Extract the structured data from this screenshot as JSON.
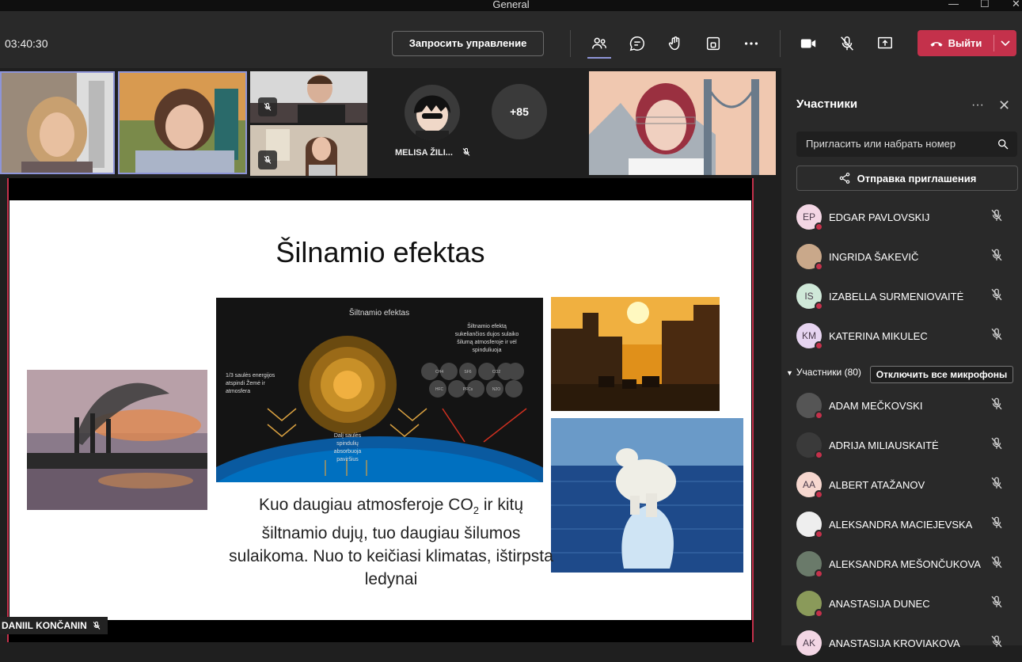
{
  "window": {
    "title": "General",
    "minimize": "—",
    "maximize": "☐",
    "close": "✕"
  },
  "toolbar": {
    "timer": "03:40:30",
    "request_control": "Запросить управление",
    "leave": "Выйти"
  },
  "stage": {
    "melisa_name": "MELISA ŽILI...",
    "more_count": "+85",
    "presenter_name": "DANIIL KONČANIN"
  },
  "slide": {
    "title": "Šilnamio efektas",
    "caption_part1": "Kuo daugiau atmosferoje CO",
    "caption_sub": "2",
    "caption_part2": " ir kitų šiltnamio dujų, tuo daugiau šilumos sulaikoma. Nuo to keičiasi klimatas, ištirpsta ledynai",
    "diagram": {
      "title": "Šiltnamio efektas",
      "right_text": [
        "Šiltnamio efektą",
        "sukeliančios dujos sulaiko",
        "šilumą atmosferoje ir vėl",
        "spinduliuoja"
      ],
      "left_text": [
        "1/3 saulės energijos",
        "atspindi Žemė ir",
        "atmosfera"
      ],
      "bottom_text": [
        "Dalį saulės",
        "spindulių",
        "absorbuoja",
        "paviršius"
      ],
      "gases": [
        "CH4",
        "SF6",
        "CO2",
        "HFC",
        "PFCs",
        "N2O"
      ]
    }
  },
  "panel": {
    "title": "Участники",
    "more": "···",
    "close": "✕",
    "invite_placeholder": "Пригласить или набрать номер",
    "send_invite": "Отправка приглашения",
    "presenters": [
      {
        "initials": "EP",
        "name": "EDGAR PAVLOVSKIJ",
        "color": "#f3d6e4"
      },
      {
        "initials": "",
        "name": "INGRIDA ŠAKEVIČ",
        "color": "#c9a88a"
      },
      {
        "initials": "IS",
        "name": "IZABELLA SURMENIOVAITĖ",
        "color": "#cfe8d8"
      },
      {
        "initials": "KM",
        "name": "KATERINA MIKULEC",
        "color": "#e6d4f0"
      }
    ],
    "group_header": "Участники (80)",
    "mute_all": "Отключить все микрофоны",
    "attendees": [
      {
        "initials": "",
        "name": "ADAM MEČKOVSKI",
        "color": "#555"
      },
      {
        "initials": "",
        "name": "ADRIJA MILIAUSKAITĖ",
        "color": "#3a3a3a"
      },
      {
        "initials": "AA",
        "name": "ALBERT ATAŽANOV",
        "color": "#f6d7cf"
      },
      {
        "initials": "",
        "name": "ALEKSANDRA MACIEJEVSKA",
        "color": "#eee"
      },
      {
        "initials": "",
        "name": "ALEKSANDRA MEŠONČUKOVA",
        "color": "#6a7a6a"
      },
      {
        "initials": "",
        "name": "ANASTASIJA DUNEC",
        "color": "#8a9a5a"
      },
      {
        "initials": "AK",
        "name": "ANASTASIJA KROVIAKOVA",
        "color": "#f3d6e4"
      }
    ]
  }
}
